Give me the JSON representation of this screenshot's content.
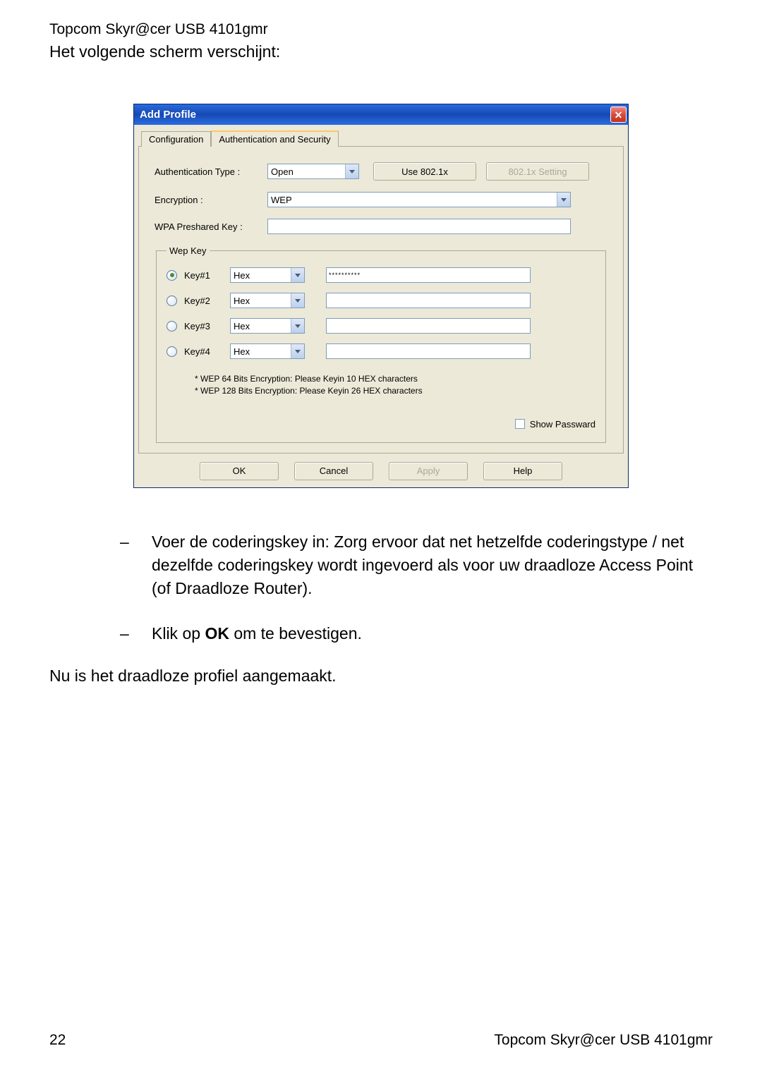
{
  "doc": {
    "header": "Topcom Skyr@cer USB 4101gmr",
    "intro": "Het volgende scherm verschijnt:",
    "bullet1": "Voer de coderingskey in: Zorg ervoor dat net hetzelfde coderingstype / net dezelfde coderingskey wordt ingevoerd als voor uw draadloze Access Point (of Draadloze Router).",
    "bullet2_pre": "Klik op ",
    "bullet2_bold": "OK",
    "bullet2_post": " om te bevestigen.",
    "final": "Nu is het draadloze profiel aangemaakt.",
    "page_num": "22",
    "footer_right": "Topcom Skyr@cer USB 4101gmr"
  },
  "dialog": {
    "title": "Add Profile",
    "tabs": {
      "config": "Configuration",
      "auth": "Authentication and Security"
    },
    "labels": {
      "auth_type": "Authentication Type :",
      "encryption": "Encryption :",
      "wpa_psk": "WPA Preshared Key :",
      "wep_legend": "Wep Key",
      "show_pw": "Show Passward",
      "hint1": "* WEP 64 Bits Encryption:   Please Keyin 10 HEX characters",
      "hint2": "* WEP 128 Bits Encryption:   Please Keyin 26 HEX characters"
    },
    "values": {
      "auth_type": "Open",
      "use_8021x": "Use 802.1x",
      "setting_8021x": "802.1x Setting",
      "encryption": "WEP",
      "wpa_psk": "",
      "keys": [
        {
          "label": "Key#1",
          "format": "Hex",
          "value": "**********",
          "selected": true
        },
        {
          "label": "Key#2",
          "format": "Hex",
          "value": "",
          "selected": false
        },
        {
          "label": "Key#3",
          "format": "Hex",
          "value": "",
          "selected": false
        },
        {
          "label": "Key#4",
          "format": "Hex",
          "value": "",
          "selected": false
        }
      ]
    },
    "buttons": {
      "ok": "OK",
      "cancel": "Cancel",
      "apply": "Apply",
      "help": "Help"
    }
  }
}
